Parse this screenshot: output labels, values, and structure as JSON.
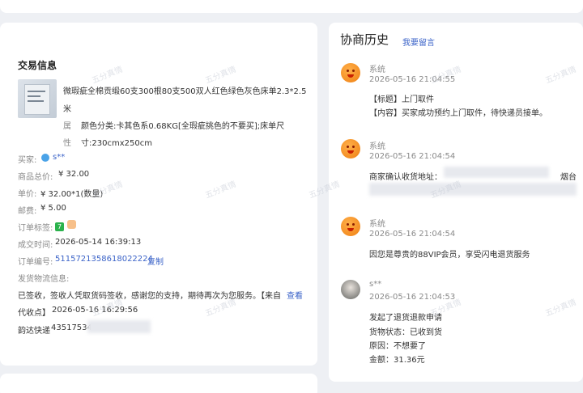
{
  "order": {
    "section_title": "交易信息",
    "product": {
      "title_line1": "微瑕疵全棉贡缎60支300根80支500双人红色绿色灰色床单2.3*2.5",
      "title_line2": "米",
      "attr_label1": "属",
      "attr_label2": "性",
      "attr_value1": "颜色分类:卡其色系0.68KG[全瑕疵挑色的不要买];床单尺",
      "attr_value2": "寸:230cmx250cm"
    },
    "buyer_label": "买家:",
    "buyer_name": "s**",
    "goods_total_label": "商品总价:",
    "goods_total": "¥ 32.00",
    "unit_price_label": "单价:",
    "unit_price": "¥ 32.00*1(数量)",
    "shipping_label": "邮费:",
    "shipping": "¥ 5.00",
    "tags_label": "订单标签:",
    "tag_badge": "7",
    "deal_time_label": "成交时间:",
    "deal_time": "2026-05-14 16:39:13",
    "order_no_label": "订单编号:",
    "order_no": "5115721358618022224",
    "copy_label": "复制",
    "logistics_label": "发货物流信息:",
    "logistics_line1": "已签收，签收人凭取货码签收，感谢您的支持，期待再次为您服务。【来自",
    "logistics_view": "查看",
    "logistics_line2_prefix": "代收点】",
    "logistics_time": "2026-05-16 16:29:56",
    "courier": "韵达快递",
    "tracking_partial": "43517534"
  },
  "history": {
    "title": "协商历史",
    "leave_message": "我要留言",
    "entries": [
      {
        "sender": "系统",
        "time": "2026-05-16 21:04:55",
        "line1": "【标题】上门取件",
        "line2": "【内容】买家成功预约上门取件，待快递员接单。"
      },
      {
        "sender": "系统",
        "time": "2026-05-16 21:04:54",
        "line1": "商家确认收货地址：",
        "line1_tail": "烟台"
      },
      {
        "sender": "系统",
        "time": "2026-05-16 21:04:54",
        "line1": "因您是尊贵的88VIP会员，享受闪电退货服务"
      },
      {
        "sender": "s**",
        "time": "2026-05-16 21:04:53",
        "line1": "发起了退货退款申请",
        "line2": "货物状态：已收到货",
        "line3": "原因：不想要了",
        "line4": "金额：31.36元"
      }
    ]
  },
  "watermark_text": "五分真情",
  "colors": {
    "link": "#3b63c8",
    "avatar_orange": "#ef7f12",
    "tag_green": "#2bb24c"
  }
}
